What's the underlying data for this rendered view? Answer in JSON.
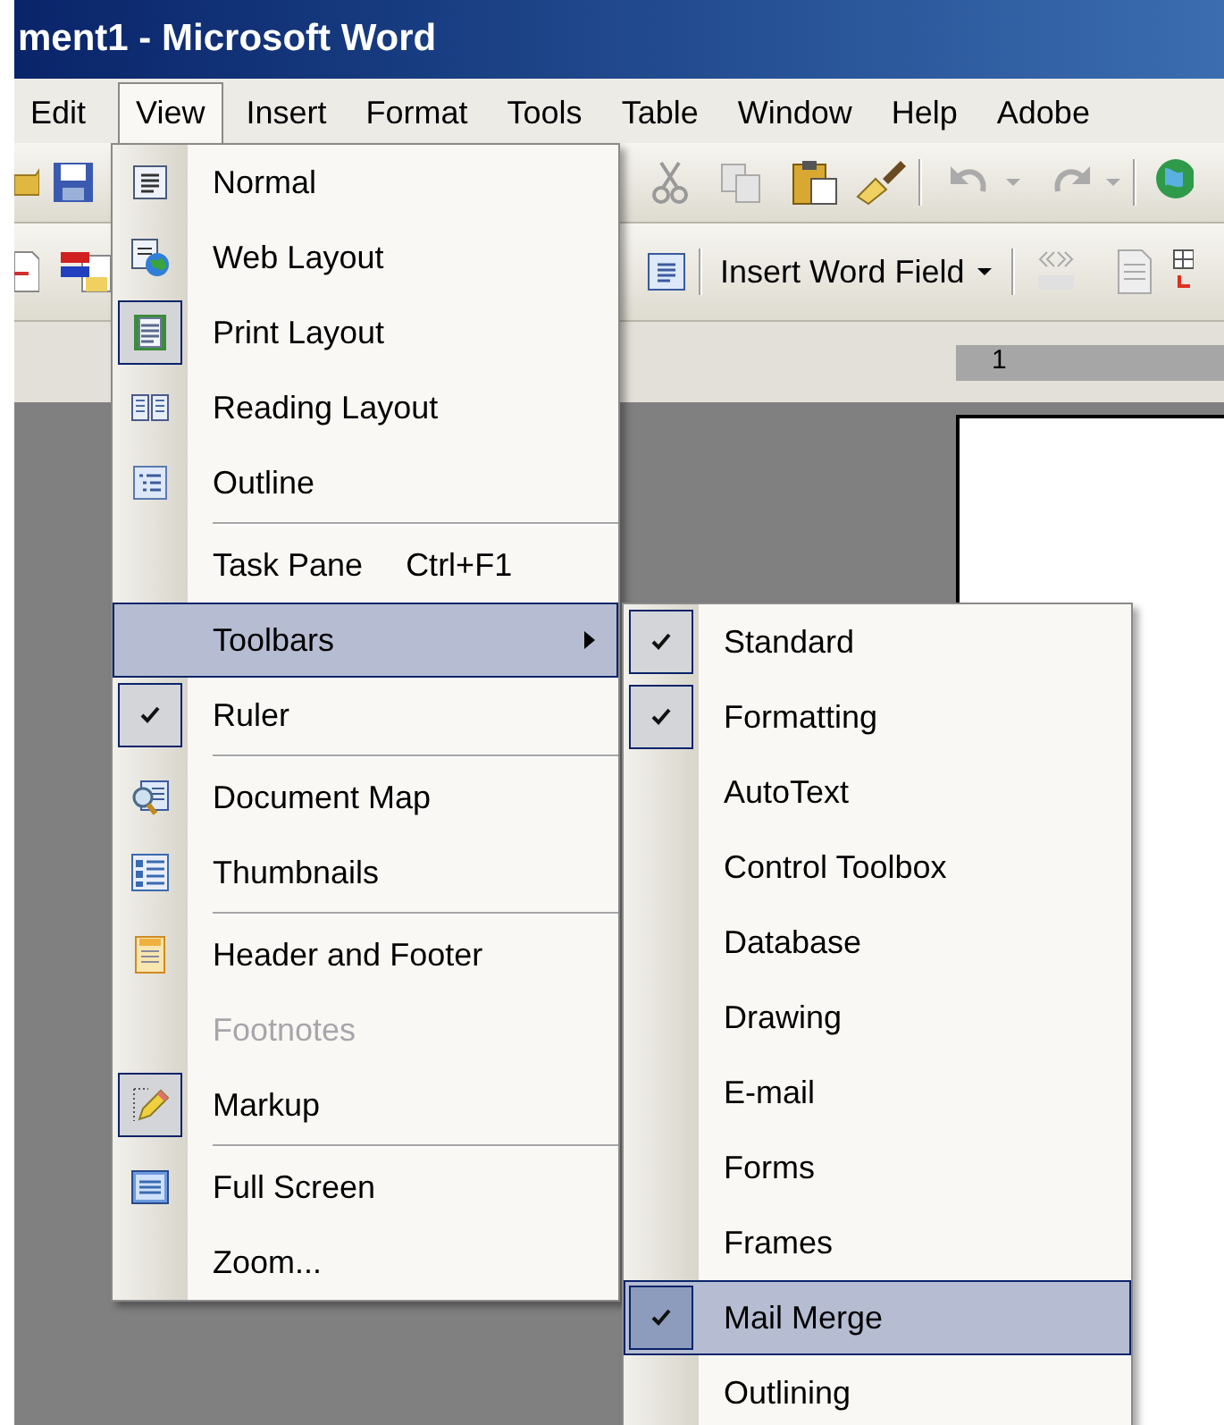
{
  "window": {
    "title": "ment1 - Microsoft Word"
  },
  "menu_bar": [
    {
      "label": "Edit",
      "selected": false
    },
    {
      "label": "View",
      "selected": true
    },
    {
      "label": "Insert",
      "selected": false
    },
    {
      "label": "Format",
      "selected": false
    },
    {
      "label": "Tools",
      "selected": false
    },
    {
      "label": "Table",
      "selected": false
    },
    {
      "label": "Window",
      "selected": false
    },
    {
      "label": "Help",
      "selected": false
    },
    {
      "label": "Adobe",
      "selected": false
    }
  ],
  "mail_merge_toolbar": {
    "insert_field_button": "Insert Word Field"
  },
  "ruler": {
    "mark": "1"
  },
  "view_menu": {
    "items": [
      {
        "kind": "item",
        "label": "Normal",
        "checked": false,
        "selected": false,
        "disabled": false,
        "submenu": false
      },
      {
        "kind": "item",
        "label": "Web Layout",
        "checked": false,
        "selected": false,
        "disabled": false,
        "submenu": false
      },
      {
        "kind": "item",
        "label": "Print Layout",
        "checked": true,
        "selected": false,
        "disabled": false,
        "submenu": false
      },
      {
        "kind": "item",
        "label": "Reading Layout",
        "checked": false,
        "selected": false,
        "disabled": false,
        "submenu": false
      },
      {
        "kind": "item",
        "label": "Outline",
        "checked": false,
        "selected": false,
        "disabled": false,
        "submenu": false
      },
      {
        "kind": "separator"
      },
      {
        "kind": "item",
        "label": "Task Pane",
        "shortcut": "Ctrl+F1",
        "checked": false,
        "selected": false,
        "disabled": false,
        "submenu": false
      },
      {
        "kind": "item",
        "label": "Toolbars",
        "checked": false,
        "selected": true,
        "disabled": false,
        "submenu": true
      },
      {
        "kind": "item",
        "label": "Ruler",
        "checked": true,
        "selected": false,
        "disabled": false,
        "submenu": false
      },
      {
        "kind": "separator"
      },
      {
        "kind": "item",
        "label": "Document Map",
        "checked": false,
        "selected": false,
        "disabled": false,
        "submenu": false
      },
      {
        "kind": "item",
        "label": "Thumbnails",
        "checked": false,
        "selected": false,
        "disabled": false,
        "submenu": false
      },
      {
        "kind": "separator"
      },
      {
        "kind": "item",
        "label": "Header and Footer",
        "checked": false,
        "selected": false,
        "disabled": false,
        "submenu": false
      },
      {
        "kind": "item",
        "label": "Footnotes",
        "checked": false,
        "selected": false,
        "disabled": true,
        "submenu": false
      },
      {
        "kind": "item",
        "label": "Markup",
        "checked": true,
        "selected": false,
        "disabled": false,
        "submenu": false
      },
      {
        "kind": "separator"
      },
      {
        "kind": "item",
        "label": "Full Screen",
        "checked": false,
        "selected": false,
        "disabled": false,
        "submenu": false
      },
      {
        "kind": "item",
        "label": "Zoom...",
        "checked": false,
        "selected": false,
        "disabled": false,
        "submenu": false
      }
    ]
  },
  "toolbars_submenu": {
    "items": [
      {
        "label": "Standard",
        "checked": true,
        "selected": false
      },
      {
        "label": "Formatting",
        "checked": true,
        "selected": false
      },
      {
        "label": "AutoText",
        "checked": false,
        "selected": false
      },
      {
        "label": "Control Toolbox",
        "checked": false,
        "selected": false
      },
      {
        "label": "Database",
        "checked": false,
        "selected": false
      },
      {
        "label": "Drawing",
        "checked": false,
        "selected": false
      },
      {
        "label": "E-mail",
        "checked": false,
        "selected": false
      },
      {
        "label": "Forms",
        "checked": false,
        "selected": false
      },
      {
        "label": "Frames",
        "checked": false,
        "selected": false
      },
      {
        "label": "Mail Merge",
        "checked": true,
        "selected": true
      },
      {
        "label": "Outlining",
        "checked": false,
        "selected": false
      }
    ]
  }
}
